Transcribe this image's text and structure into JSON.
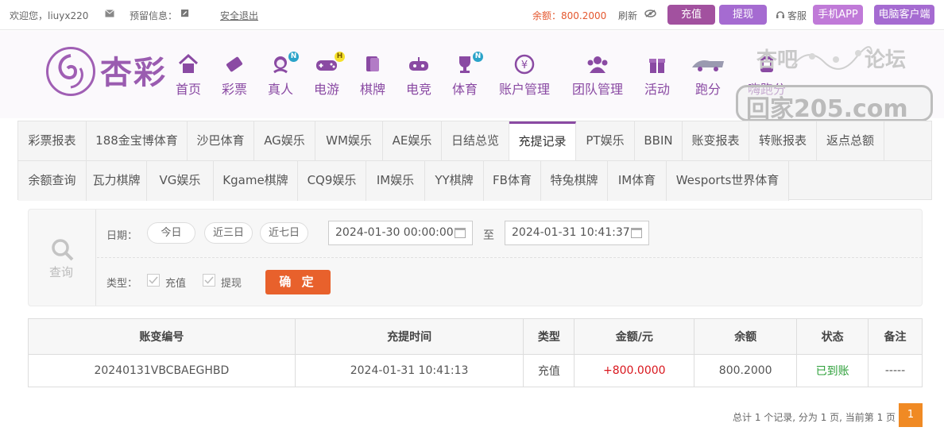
{
  "topbar": {
    "welcome": "欢迎您，liuyx220",
    "notice_label": "预留信息：",
    "logout": "安全退出",
    "balance": "余额：800.2000",
    "refresh": "刷新",
    "recharge": "充值",
    "withdraw": "提现",
    "service": "客服",
    "mobile_app": "手机APP",
    "pc_client": "电脑客户端"
  },
  "logo": {
    "text": "杏彩"
  },
  "nav": [
    {
      "label": "首页",
      "icon": "home-icon"
    },
    {
      "label": "彩票",
      "icon": "ticket-icon"
    },
    {
      "label": "真人",
      "icon": "dealer-icon",
      "badge": "N"
    },
    {
      "label": "电游",
      "icon": "gamepad-icon",
      "badge": "H"
    },
    {
      "label": "棋牌",
      "icon": "cards-icon"
    },
    {
      "label": "电竞",
      "icon": "esports-icon"
    },
    {
      "label": "体育",
      "icon": "trophy-icon",
      "badge": "N"
    },
    {
      "label": "账户管理",
      "icon": "yen-icon"
    },
    {
      "label": "团队管理",
      "icon": "team-icon"
    },
    {
      "label": "活动",
      "icon": "gift-icon"
    },
    {
      "label": "跑分",
      "icon": "run-icon"
    },
    {
      "label": "嗨跑分",
      "icon": "run2-icon"
    }
  ],
  "watermark": {
    "line1": "杏吧",
    "line2": "论坛",
    "line3": "回家205.com"
  },
  "tabs": {
    "row1": [
      "彩票报表",
      "188金宝博体育",
      "沙巴体育",
      "AG娱乐",
      "WM娱乐",
      "AE娱乐",
      "日结总览",
      "充提记录",
      "PT娱乐",
      "BBIN",
      "账变报表",
      "转账报表",
      "返点总额"
    ],
    "row2": [
      "余额查询",
      "瓦力棋牌",
      "VG娱乐",
      "Kgame棋牌",
      "CQ9娱乐",
      "IM娱乐",
      "YY棋牌",
      "FB体育",
      "特兔棋牌",
      "IM体育",
      "Wesports世界体育"
    ],
    "active": "充提记录"
  },
  "query": {
    "side_label": "查询",
    "date_label": "日期：",
    "today": "今日",
    "three_days": "近三日",
    "seven_days": "近七日",
    "start": "2024-01-30 00:00:00",
    "to": "至",
    "end": "2024-01-31 10:41:37",
    "type_label": "类型：",
    "type_recharge": "充值",
    "type_withdraw": "提现",
    "confirm": "确 定"
  },
  "table": {
    "headers": [
      "账变编号",
      "充提时间",
      "类型",
      "金额/元",
      "余额",
      "状态",
      "备注"
    ],
    "rows": [
      [
        "20240131VBCBAEGHBD",
        "2024-01-31 10:41:13",
        "充值",
        "+800.0000",
        "800.2000",
        "已到账",
        "-----"
      ]
    ]
  },
  "pager": {
    "summary": "总计 1 个记录, 分为 1 页, 当前第 1 页",
    "current": "1"
  },
  "colors": {
    "brand": "#8a4aa3",
    "accent": "#e8612c",
    "amount": "#d9171e",
    "success": "#2ea03a"
  }
}
